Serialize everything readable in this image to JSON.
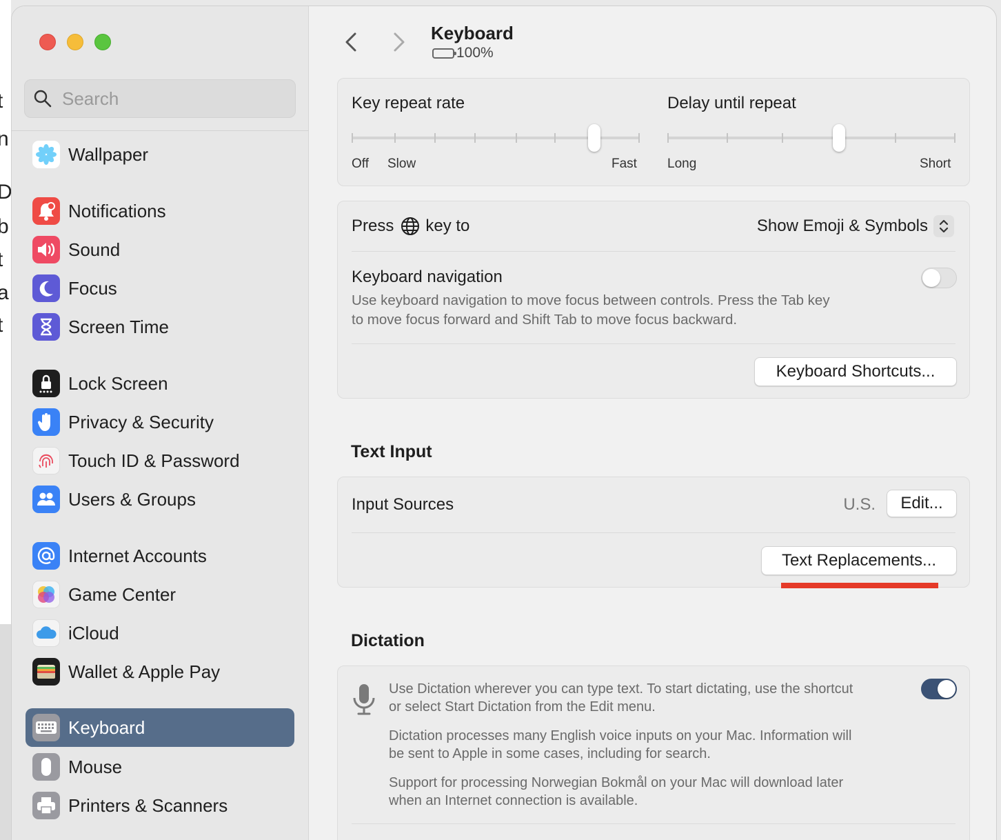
{
  "window": {
    "title": "Keyboard",
    "battery_text": "100%"
  },
  "search": {
    "placeholder": "Search"
  },
  "sidebar": {
    "items": [
      {
        "label": "Wallpaper",
        "icon": "wallpaper-icon",
        "color": "#40a9e8"
      },
      {
        "label": "Notifications",
        "icon": "notifications-icon",
        "color": "#ef4b45"
      },
      {
        "label": "Sound",
        "icon": "sound-icon",
        "color": "#ef4a63"
      },
      {
        "label": "Focus",
        "icon": "focus-moon-icon",
        "color": "#5e5ad6"
      },
      {
        "label": "Screen Time",
        "icon": "hourglass-icon",
        "color": "#5e5ad6"
      },
      {
        "label": "Lock Screen",
        "icon": "lock-icon",
        "color": "#1e1e1e"
      },
      {
        "label": "Privacy & Security",
        "icon": "hand-icon",
        "color": "#3a82f6"
      },
      {
        "label": "Touch ID & Password",
        "icon": "fingerprint-icon",
        "color": "#f4f4f4"
      },
      {
        "label": "Users & Groups",
        "icon": "users-icon",
        "color": "#3a82f6"
      },
      {
        "label": "Internet Accounts",
        "icon": "at-icon",
        "color": "#3a82f6"
      },
      {
        "label": "Game Center",
        "icon": "game-center-icon",
        "color": "#f4f4f4"
      },
      {
        "label": "iCloud",
        "icon": "cloud-icon",
        "color": "#f4f4f4"
      },
      {
        "label": "Wallet & Apple Pay",
        "icon": "wallet-icon",
        "color": "#1e1e1e"
      },
      {
        "label": "Keyboard",
        "icon": "keyboard-icon",
        "color": "#8e8e93"
      },
      {
        "label": "Mouse",
        "icon": "mouse-icon",
        "color": "#8e8e93"
      },
      {
        "label": "Printers & Scanners",
        "icon": "printer-icon",
        "color": "#8e8e93"
      }
    ],
    "selected": "Keyboard"
  },
  "repeat": {
    "rate_label": "Key repeat rate",
    "rate_off": "Off",
    "rate_slow": "Slow",
    "rate_fast": "Fast",
    "rate_value_fraction": 0.84,
    "delay_label": "Delay until repeat",
    "delay_long": "Long",
    "delay_short": "Short",
    "delay_value_fraction": 0.6
  },
  "keys": {
    "press_prefix": "Press",
    "press_suffix": "key to",
    "press_value": "Show Emoji & Symbols",
    "nav_title": "Keyboard navigation",
    "nav_desc_1": "Use keyboard navigation to move focus between controls. Press the Tab key",
    "nav_desc_2": "to move focus forward and Shift Tab to move focus backward.",
    "nav_enabled": false,
    "shortcuts_button": "Keyboard Shortcuts..."
  },
  "text_input": {
    "section_title": "Text Input",
    "sources_label": "Input Sources",
    "sources_value": "U.S.",
    "edit_button": "Edit...",
    "replacements_button": "Text Replacements..."
  },
  "dictation": {
    "section_title": "Dictation",
    "enabled": true,
    "desc_1a": "Use Dictation wherever you can type text. To start dictating, use the shortcut",
    "desc_1b": "or select Start Dictation from the Edit menu.",
    "desc_2a": "Dictation processes many English voice inputs on your Mac. Information will",
    "desc_2b": "be sent to Apple in some cases, including for search.",
    "desc_3a": "Support for processing Norwegian Bokmål on your Mac will download later",
    "desc_3b": "when an Internet connection is available."
  },
  "colors": {
    "accent_selected": "#566d8a",
    "toggle_on": "#3b5275",
    "highlight_mark": "#e53a28"
  }
}
